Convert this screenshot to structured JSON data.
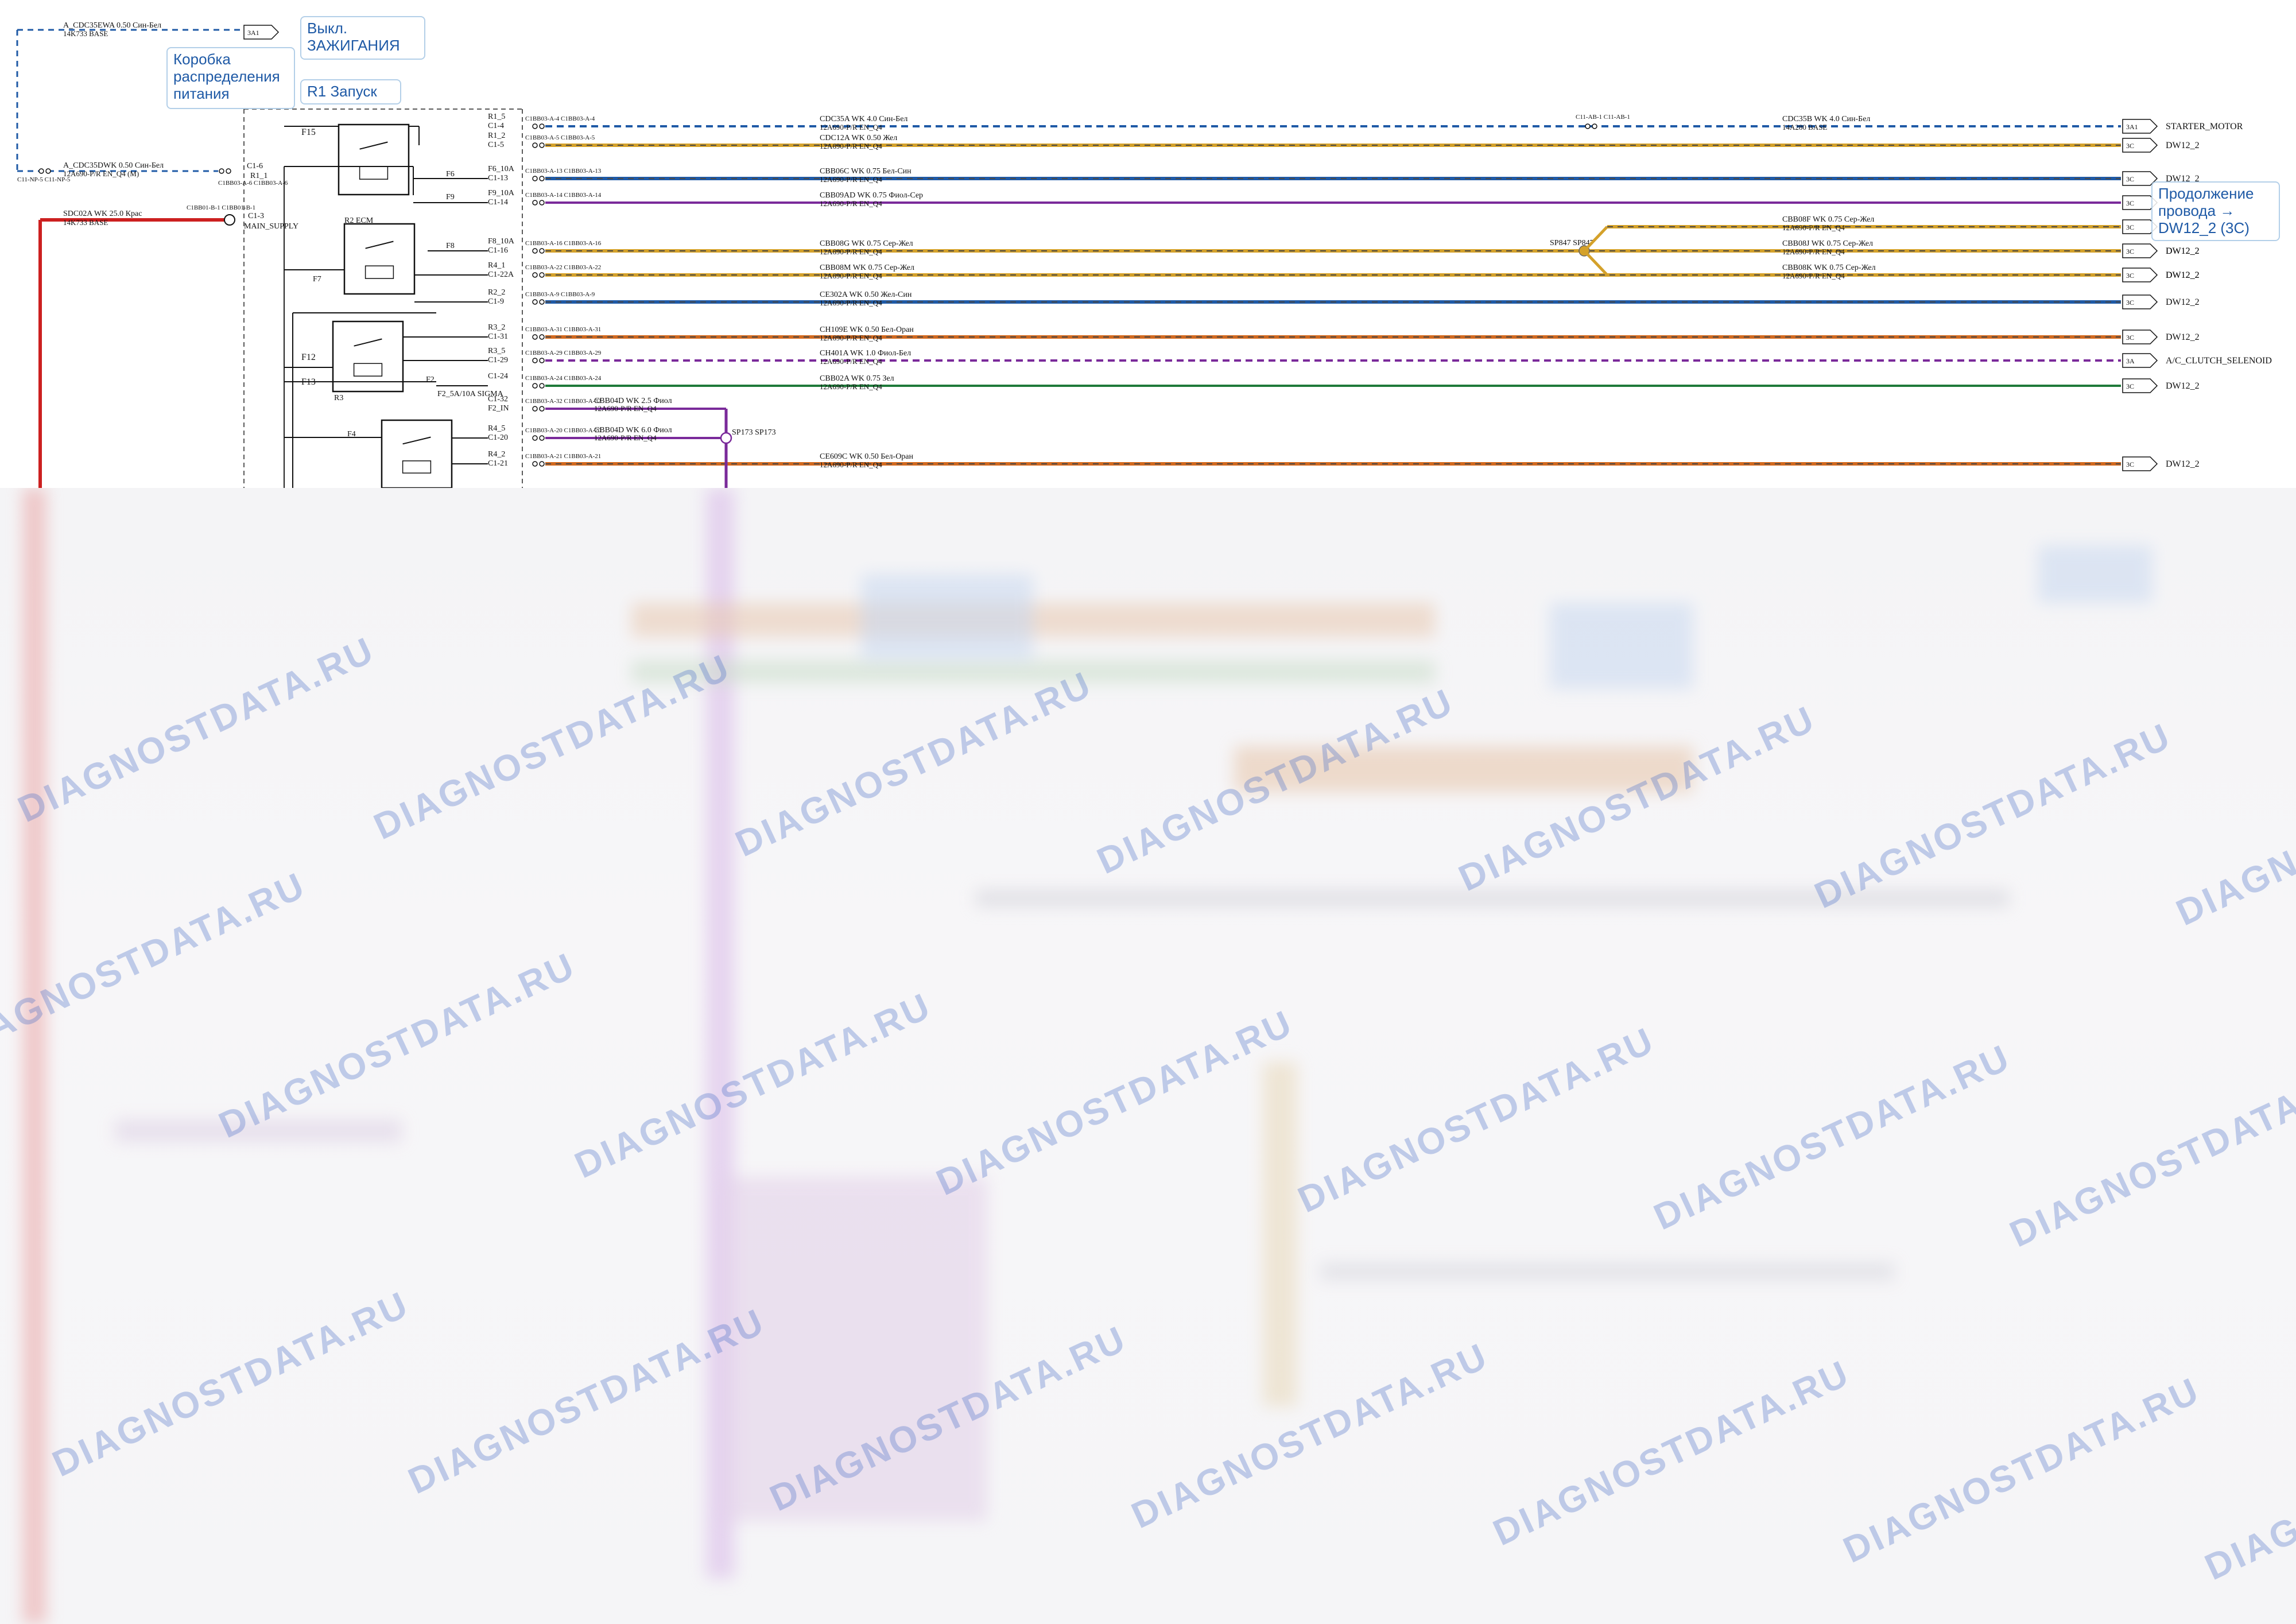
{
  "notes": {
    "ignition": "Выкл.\nЗАЖИГАНИЯ",
    "junction_box": "Коробка\nраспределения\nпитания",
    "r1_start": "R1 Запуск",
    "continuation": "Продолжение\nпровода →\nDW12_2 (3С)"
  },
  "watermark": "DIAGNOSTDATA.RU",
  "top_feed": {
    "wire1": "A_CDC35EWA 0.50",
    "wire1_color": "Син-Бел",
    "wire1_sub": "14K733",
    "wire1_base": "BASE",
    "box": "3A1",
    "wire2": "A_CDC35DWK 0.50",
    "wire2_color": "Син-Бел",
    "wire2_sub": "12A690-P/R",
    "wire2_sub2": "EN_Q4",
    "wire2_sub3": "(M)",
    "left_conn": "C11-NP-5 C11-NP-5",
    "feed_conn": "C1BB03-A-6 C1BB03-A-6",
    "main_wire": "SDC02A",
    "main_wire_spec": "WK 25.0",
    "main_wire_color": "Крас",
    "main_wire_sub": "14K733",
    "main_wire_base": "BASE",
    "main_conn": "C1BB01-B-1 C1BB01-B-1",
    "main_supply": "MAIN_SUPPLY",
    "c1_6": "C1-6",
    "r1_1": "R1_1",
    "c1_3": "C1-3"
  },
  "components": {
    "f15": "F15",
    "f6": "F6",
    "f9": "F9",
    "r2_ecm": "R2 ECM",
    "f7": "F7",
    "f8": "F8",
    "f12": "F12",
    "f13": "F13",
    "r3": "R3",
    "f2": "F2",
    "f2_label": "F2_5A/10A SIGMA",
    "f4": "F4",
    "sp173": "SP173 SP173",
    "sp847": "SP847 SP847",
    "c11_ab": "C11-AB-1 C11-AB-1"
  },
  "rows": [
    {
      "pin1": "R1_5",
      "pin2": "C1-4",
      "conn": "C1BB03-A-4 C1BB03-A-4",
      "wire": "CDC35A",
      "spec": "WK 4.0",
      "color": "Син-Бел",
      "sub": "12A690-P/R",
      "sub2": "EN_Q4",
      "wire_b": "CDC35B",
      "spec_b": "WK 4.0",
      "color_b": "Син-Бел",
      "sub_b": "14A280",
      "sub2_b": "BASE",
      "box": "3A1",
      "dest": "STARTER_MOTOR"
    },
    {
      "pin1": "R1_2",
      "pin2": "C1-5",
      "conn": "C1BB03-A-5 C1BB03-A-5",
      "wire": "CDC12A",
      "spec": "WK 0.50",
      "color": "Жел",
      "sub": "12A690-P/R",
      "sub2": "EN_Q4",
      "box": "3C",
      "dest": "DW12_2"
    },
    {
      "pin1": "F6_10A",
      "pin2": "C1-13",
      "conn": "C1BB03-A-13 C1BB03-A-13",
      "wire": "CBB06C",
      "spec": "WK 0.75",
      "color": "Бел-Син",
      "sub": "12A690-P/R",
      "sub2": "EN_Q4",
      "box": "3C",
      "dest": "DW12_2"
    },
    {
      "pin1": "F9_10A",
      "pin2": "C1-14",
      "conn": "C1BB03-A-14 C1BB03-A-14",
      "wire": "CBB09AD",
      "spec": "WK 0.75",
      "color": "Фиол-Сер",
      "sub": "12A690-P/R",
      "sub2": "EN_Q4",
      "box": "3C",
      "dest": ""
    },
    {
      "pin1": "F8_10A",
      "pin2": "C1-16",
      "conn": "C1BB03-A-16 C1BB03-A-16",
      "wire": "CBB08G",
      "spec": "WK 0.75",
      "color": "Сер-Жел",
      "sub": "12A690-P/R",
      "sub2": "EN_Q4",
      "box": "3C",
      "dest": "DW12_2"
    },
    {
      "pin1": "R4_1",
      "pin2": "C1-22A",
      "conn": "C1BB03-A-22 C1BB03-A-22",
      "wire": "CBB08M",
      "spec": "WK 0.75",
      "color": "Сер-Жел",
      "sub": "12A690-P/R",
      "sub2": "EN_Q4",
      "box": "3C",
      "dest": "DW12_2"
    },
    {
      "pin1": "R2_2",
      "pin2": "C1-9",
      "conn": "C1BB03-A-9 C1BB03-A-9",
      "wire": "CE302A",
      "spec": "WK 0.50",
      "color": "Жел-Син",
      "sub": "12A690-P/R",
      "sub2": "EN_Q4",
      "box": "3C",
      "dest": "DW12_2"
    },
    {
      "pin1": "R3_2",
      "pin2": "C1-31",
      "conn": "C1BB03-A-31 C1BB03-A-31",
      "wire": "CH109E",
      "spec": "WK 0.50",
      "color": "Бел-Оран",
      "sub": "12A690-P/R",
      "sub2": "EN_Q4",
      "box": "3C",
      "dest": "DW12_2"
    },
    {
      "pin1": "R3_5",
      "pin2": "C1-29",
      "conn": "C1BB03-A-29 C1BB03-A-29",
      "wire": "CH401A",
      "spec": "WK 1.0",
      "color": "Фиол-Бел",
      "sub": "12A690-P/R",
      "sub2": "EN_Q4",
      "box": "3A",
      "dest": "A/C_CLUTCH_SELENOID"
    },
    {
      "pin1": "C1-24",
      "pin2": "",
      "conn": "C1BB03-A-24 C1BB03-A-24",
      "wire": "CBB02A",
      "spec": "WK 0.75",
      "color": "Зел",
      "sub": "12A690-P/R",
      "sub2": "EN_Q4",
      "box": "3C",
      "dest": "DW12_2"
    },
    {
      "pin1": "C1-32",
      "pin2": "F2_IN",
      "conn": "C1BB03-A-32 C1BB03-A-32",
      "wire": "CBB04D",
      "spec": "WK 2.5",
      "color": "Фиол",
      "sub": "12A690-P/R",
      "sub2": "EN_Q4",
      "box": "",
      "dest": ""
    },
    {
      "pin1": "R4_5",
      "pin2": "C1-20",
      "conn": "C1BB03-A-20 C1BB03-A-20",
      "wire": "CBB04D",
      "spec": "WK 6.0",
      "color": "Фиол",
      "sub": "12A690-P/R",
      "sub2": "EN_Q4",
      "box": "",
      "dest": ""
    },
    {
      "pin1": "R4_2",
      "pin2": "C1-21",
      "conn": "C1BB03-A-21 C1BB03-A-21",
      "wire": "CE609C",
      "spec": "WK 0.50",
      "color": "Бел-Оран",
      "sub": "12A690-P/R",
      "sub2": "EN_Q4",
      "box": "3C",
      "dest": "DW12_2"
    }
  ],
  "branches": [
    {
      "wire": "CBB08F",
      "spec": "WK 0.75",
      "color": "Сер-Жел",
      "sub": "12A690-P/R",
      "sub2": "EN_Q4",
      "box": "3C",
      "dest": ""
    },
    {
      "wire": "CBB08J",
      "spec": "WK 0.75",
      "color": "Сер-Жел",
      "sub": "12A690-P/R",
      "sub2": "EN_Q4",
      "box": "3C",
      "dest": "DW12_2"
    },
    {
      "wire": "CBB08K",
      "spec": "WK 0.75",
      "color": "Сер-Жел",
      "sub": "12A690-P/R",
      "sub2": "EN_Q4",
      "box": "3C",
      "dest": "DW12_2"
    }
  ],
  "colors": {
    "blue_wire": "#1f5aa6",
    "orange_wire": "#d4a12a",
    "purple_wire": "#7a2a9a",
    "green_wire": "#1f7a3a",
    "red_wire": "#cc2020",
    "orange_red": "#d2691e",
    "note_text": "#1f5aa6"
  }
}
